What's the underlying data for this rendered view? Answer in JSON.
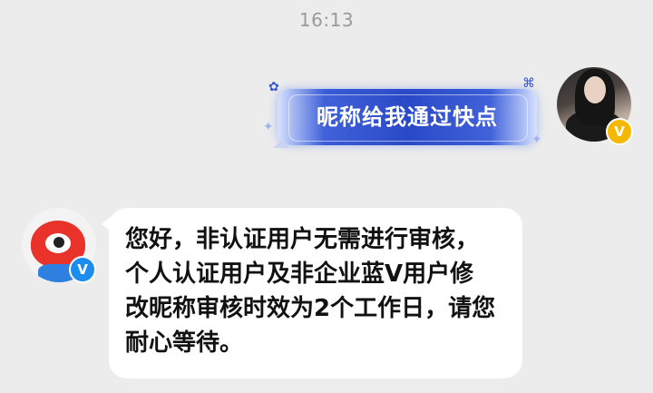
{
  "status": {
    "time": "16:13"
  },
  "messages": {
    "outgoing": {
      "text": "昵称给我通过快点",
      "badge": "V",
      "badge_color": "#f5b800",
      "bubble_color": "#2a49c8"
    },
    "incoming": {
      "text": "您好，非认证用户无需进行审核，个人认证用户及非企业蓝V用户修改昵称审核时效为2个工作日，请您耐心等待。",
      "badge": "V",
      "badge_color": "#1d8cf0",
      "bubble_color": "#ffffff"
    }
  }
}
